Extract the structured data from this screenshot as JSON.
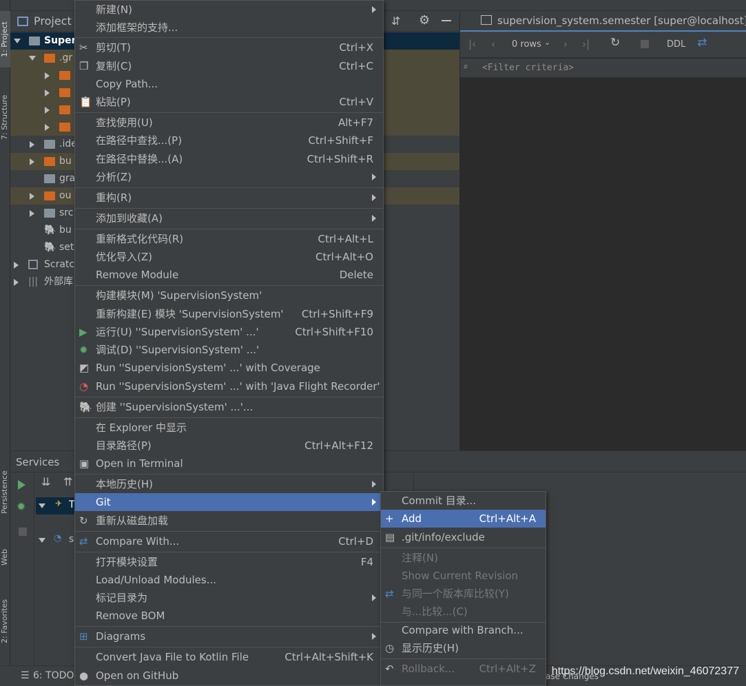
{
  "left_stripe": {
    "tabs": [
      "1: Project",
      "7: Structure",
      "Persistence",
      "Web",
      "2: Favorites"
    ]
  },
  "project_panel": {
    "title": "Project",
    "root": "Super",
    "rows": [
      {
        "label": ".gr"
      },
      {
        "label": ""
      },
      {
        "label": ""
      },
      {
        "label": ""
      },
      {
        "label": ""
      },
      {
        "label": ".ide"
      },
      {
        "label": "bu"
      },
      {
        "label": "gra"
      },
      {
        "label": "ou"
      },
      {
        "label": "src"
      },
      {
        "label": "bu"
      },
      {
        "label": "set"
      },
      {
        "label": "Scratc"
      },
      {
        "label": "外部库"
      }
    ]
  },
  "db_panel": {
    "tab_title": "supervision_system.semester [super@localhost]",
    "rows_label": "0 rows",
    "ddl_label": "DDL",
    "filter_placeholder": "<Filter criteria>"
  },
  "services": {
    "title": "Services",
    "tree": [
      "T",
      "s"
    ]
  },
  "status_bar": {
    "todo": "6: TODO",
    "right_fragment": "ase Changes",
    "watermark": "https://blog.csdn.net/weixin_46072377"
  },
  "context_menu": {
    "items": [
      {
        "label": "新建(N)",
        "shortcut": "",
        "submenu": true
      },
      {
        "label": "添加框架的支持...",
        "shortcut": ""
      },
      {
        "label": "剪切(T)",
        "shortcut": "Ctrl+X",
        "icon": "scissors-icon"
      },
      {
        "label": "复制(C)",
        "shortcut": "Ctrl+C",
        "icon": "copy-icon"
      },
      {
        "label": "Copy Path...",
        "shortcut": ""
      },
      {
        "label": "粘贴(P)",
        "shortcut": "Ctrl+V",
        "icon": "paste-icon"
      },
      {
        "label": "查找使用(U)",
        "shortcut": "Alt+F7"
      },
      {
        "label": "在路径中查找...(P)",
        "shortcut": "Ctrl+Shift+F"
      },
      {
        "label": "在路径中替换...(A)",
        "shortcut": "Ctrl+Shift+R"
      },
      {
        "label": "分析(Z)",
        "shortcut": "",
        "submenu": true
      },
      {
        "label": "重构(R)",
        "shortcut": "",
        "submenu": true
      },
      {
        "label": "添加到收藏(A)",
        "shortcut": "",
        "submenu": true
      },
      {
        "label": "重新格式化代码(R)",
        "shortcut": "Ctrl+Alt+L"
      },
      {
        "label": "优化导入(Z)",
        "shortcut": "Ctrl+Alt+O"
      },
      {
        "label": "Remove Module",
        "shortcut": "Delete"
      },
      {
        "label": "构建模块(M) 'SupervisionSystem'",
        "shortcut": ""
      },
      {
        "label": "重新构建(E) 模块 'SupervisionSystem'",
        "shortcut": "Ctrl+Shift+F9"
      },
      {
        "label": "运行(U) ''SupervisionSystem' ...'",
        "shortcut": "Ctrl+Shift+F10",
        "icon": "run-icon"
      },
      {
        "label": "调试(D) ''SupervisionSystem' ...'",
        "shortcut": "",
        "icon": "debug-icon"
      },
      {
        "label": "Run ''SupervisionSystem' ...' with Coverage",
        "shortcut": "",
        "icon": "coverage-icon"
      },
      {
        "label": "Run ''SupervisionSystem' ...' with 'Java Flight Recorder'",
        "shortcut": "",
        "icon": "profiler-icon"
      },
      {
        "label": "创建 ''SupervisionSystem' ...'...",
        "shortcut": "",
        "icon": "gradle-icon"
      },
      {
        "label": "在 Explorer 中显示",
        "shortcut": ""
      },
      {
        "label": "目录路径(P)",
        "shortcut": "Ctrl+Alt+F12"
      },
      {
        "label": "Open in Terminal",
        "shortcut": "",
        "icon": "terminal-icon"
      },
      {
        "label": "本地历史(H)",
        "shortcut": "",
        "submenu": true
      },
      {
        "label": "Git",
        "shortcut": "",
        "submenu": true,
        "selected": true
      },
      {
        "label": "重新从磁盘加载",
        "shortcut": "",
        "icon": "reload-icon"
      },
      {
        "label": "Compare With...",
        "shortcut": "Ctrl+D",
        "icon": "compare-icon"
      },
      {
        "label": "打开模块设置",
        "shortcut": "F4"
      },
      {
        "label": "Load/Unload Modules...",
        "shortcut": ""
      },
      {
        "label": "标记目录为",
        "shortcut": "",
        "submenu": true
      },
      {
        "label": "Remove BOM",
        "shortcut": ""
      },
      {
        "label": "Diagrams",
        "shortcut": "",
        "submenu": true,
        "icon": "diagram-icon"
      },
      {
        "label": "Convert Java File to Kotlin File",
        "shortcut": "Ctrl+Alt+Shift+K"
      },
      {
        "label": "Open on GitHub",
        "shortcut": "",
        "icon": "github-icon"
      }
    ]
  },
  "git_submenu": {
    "items": [
      {
        "label": "Commit 目录...",
        "shortcut": ""
      },
      {
        "label": "Add",
        "shortcut": "Ctrl+Alt+A",
        "selected": true,
        "icon": "plus-icon"
      },
      {
        "label": ".git/info/exclude",
        "shortcut": "",
        "icon": "file-icon"
      },
      {
        "label": "注释(N)",
        "shortcut": "",
        "disabled": true
      },
      {
        "label": "Show Current Revision",
        "shortcut": "",
        "disabled": true
      },
      {
        "label": "与同一个版本库比较(Y)",
        "shortcut": "",
        "disabled": true,
        "icon": "compare-icon"
      },
      {
        "label": "与...比较...(C)",
        "shortcut": "",
        "disabled": true
      },
      {
        "label": "Compare with Branch...",
        "shortcut": ""
      },
      {
        "label": "显示历史(H)",
        "shortcut": "",
        "icon": "clock-icon"
      },
      {
        "label": "Rollback...",
        "shortcut": "Ctrl+Alt+Z",
        "disabled": true,
        "icon": "rollback-icon"
      }
    ]
  },
  "colors": {
    "selection": "#4b6eaf",
    "menu_bg": "#3c3f41",
    "editor_bg": "#2b2b2b",
    "folder_orange": "#d26722"
  }
}
